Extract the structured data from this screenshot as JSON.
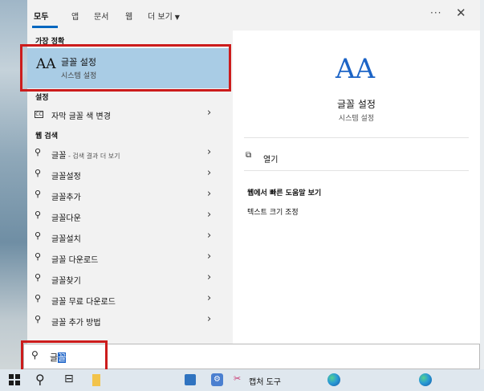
{
  "tabs": [
    {
      "label": "모두",
      "active": true
    },
    {
      "label": "앱",
      "active": false
    },
    {
      "label": "문서",
      "active": false
    },
    {
      "label": "웹",
      "active": false
    },
    {
      "label": "더 보기",
      "active": false
    }
  ],
  "more_icon": "ellipsis-icon",
  "close_icon": "close-icon",
  "sections": {
    "best_match": "가장 정확",
    "settings": "설정",
    "web_search": "웹 검색"
  },
  "best_match": {
    "title": "글꼴 설정",
    "subtitle": "시스템 설정",
    "icon_text": "AA"
  },
  "settings_items": [
    {
      "label": "자막 글꼴 색 변경"
    }
  ],
  "web_items": [
    {
      "label": "글꼴",
      "hint": " - 검색 결과 더 보기"
    },
    {
      "label": "글꼴설정",
      "hint": ""
    },
    {
      "label": "글꼴추가",
      "hint": ""
    },
    {
      "label": "글꼴다운",
      "hint": ""
    },
    {
      "label": "글꼴설치",
      "hint": ""
    },
    {
      "label": "글꼴 다운로드",
      "hint": ""
    },
    {
      "label": "글꼴찾기",
      "hint": ""
    },
    {
      "label": "글꼴 무료 다운로드",
      "hint": ""
    },
    {
      "label": "글꼴 추가 방법",
      "hint": ""
    }
  ],
  "detail": {
    "icon_text": "AA",
    "title": "글꼴 설정",
    "subtitle": "시스템 설정",
    "open_label": "열기",
    "web_heading": "웹에서 빠른 도움말 보기",
    "web_link": "텍스트 크기 조정"
  },
  "search": {
    "typed": "글",
    "selected": "꼴"
  },
  "taskbar": {
    "snip_label": "캡처 도구"
  },
  "colors": {
    "accent": "#0067c0",
    "selection": "#a9cce5",
    "highlight_box": "#cc1c1c"
  }
}
